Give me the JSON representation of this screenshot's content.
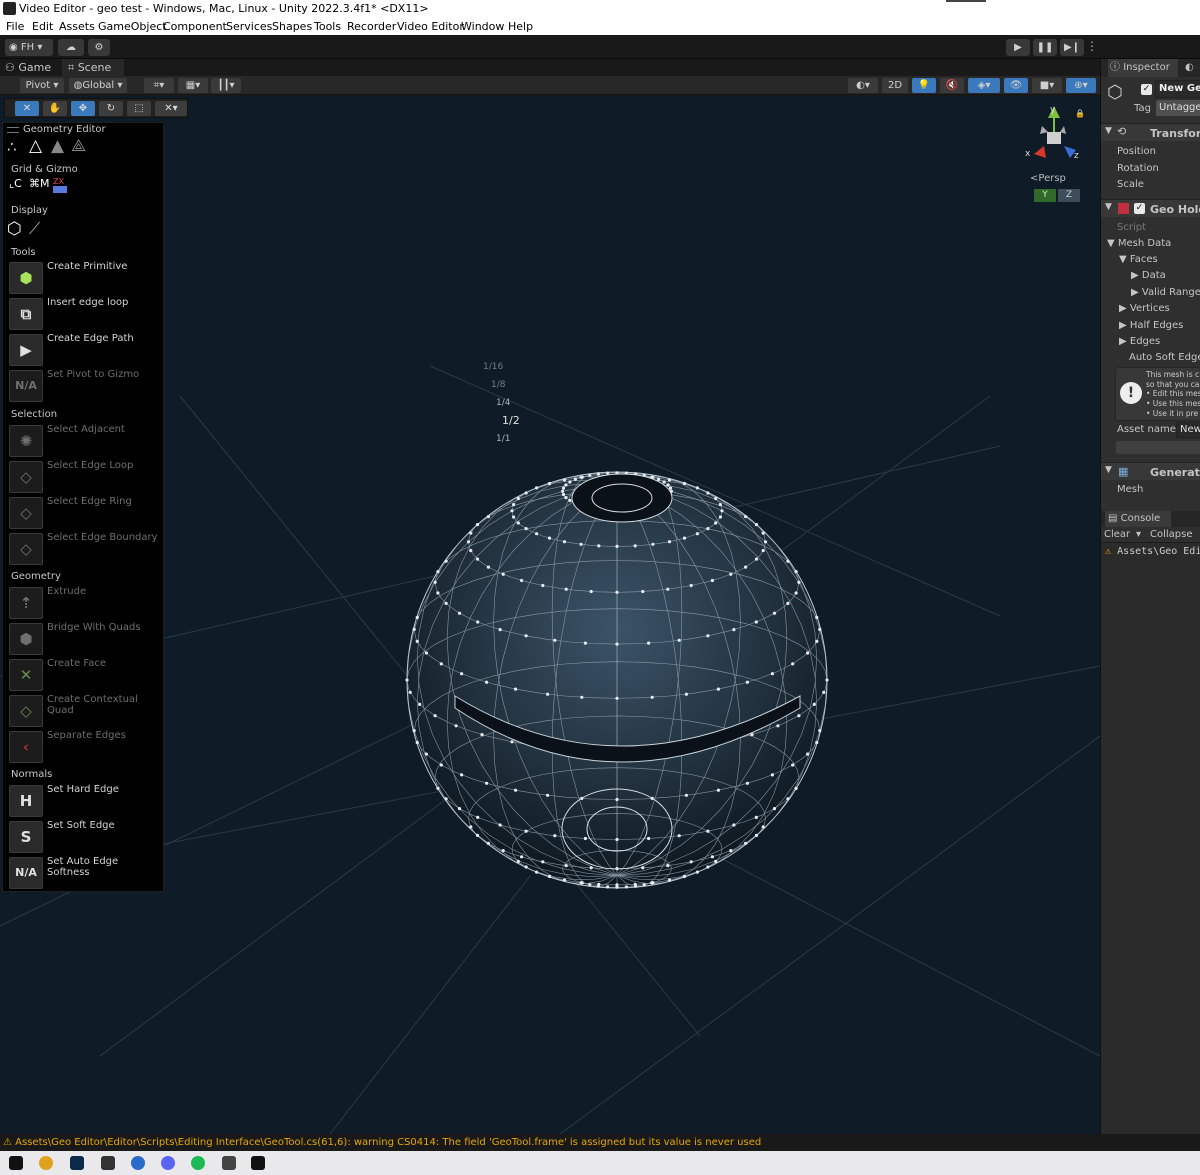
{
  "window": {
    "title": "Video Editor - geo test - Windows, Mac, Linux - Unity 2022.3.4f1* <DX11>"
  },
  "menu": [
    "File",
    "Edit",
    "Assets",
    "GameObject",
    "Component",
    "Services",
    "Shapes",
    "Tools",
    "Recorder",
    "Video Editor",
    "Window",
    "Help"
  ],
  "toolbar": {
    "account": "FH"
  },
  "tabs": {
    "game": "Game",
    "scene": "Scene",
    "inspector": "Inspector",
    "lighting": "L"
  },
  "scene_toolbar": {
    "pivot": "Pivot",
    "global": "Global",
    "mode2d": "2D"
  },
  "overlay": {
    "title": "Geometry Editor",
    "sections": {
      "grid": "Grid & Gizmo",
      "display": "Display",
      "tools": "Tools",
      "selection": "Selection",
      "geometry": "Geometry",
      "normals": "Normals"
    },
    "grid_labels": {
      "c": "C",
      "m": "M",
      "zx": "ZX"
    },
    "tools": [
      "Create Primitive",
      "Insert edge loop",
      "Create Edge Path",
      "Set Pivot to Gizmo"
    ],
    "selection": [
      "Select Adjacent",
      "Select Edge Loop",
      "Select Edge Ring",
      "Select Edge Boundary"
    ],
    "geometry": [
      "Extrude",
      "Bridge With Quads",
      "Create Face",
      "Create Contextual Quad",
      "Separate Edges"
    ],
    "normals": [
      "Set Hard Edge",
      "Set Soft Edge",
      "Set Auto Edge Softness"
    ],
    "icon_text": {
      "na": "N/A",
      "h": "H",
      "s": "S"
    }
  },
  "grid_scale": [
    "1/16",
    "1/8",
    "1/4",
    "1/2",
    "1/1"
  ],
  "gizmo": {
    "persp": "Persp",
    "y": "Y",
    "z": "Z",
    "axis_y": "y",
    "axis_x": "x",
    "axis_z": "z"
  },
  "inspector": {
    "object_name": "New Geo",
    "tag_label": "Tag",
    "tag_value": "Untagged",
    "transform": "Transform",
    "position": "Position",
    "rotation": "Rotation",
    "scale": "Scale",
    "component": "Geo Holder",
    "script": "Script",
    "mesh_data": "Mesh Data",
    "faces": "Faces",
    "data": "Data",
    "valid_ranges": "Valid Ranges",
    "vertices": "Vertices",
    "half_edges": "Half Edges",
    "edges": "Edges",
    "auto_soft": "Auto Soft Edge",
    "help": [
      "This mesh is c",
      "so that you ca",
      "• Edit this mes",
      "• Use this mes",
      "• Use it in pre"
    ],
    "asset_name": "Asset name",
    "asset_value": "New",
    "generated": "Generated",
    "mesh": "Mesh"
  },
  "console": {
    "tab": "Console",
    "clear": "Clear",
    "collapse": "Collapse",
    "entry": "Assets\\Geo Edi"
  },
  "status": "Assets\\Geo Editor\\Editor\\Scripts\\Editing Interface\\GeoTool.cs(61,6): warning CS0414: The field 'GeoTool.frame' is assigned but its value is never used",
  "colors": {
    "viewport": "#0f1b26",
    "accent": "#3a79bb",
    "warning": "#e5a800"
  }
}
